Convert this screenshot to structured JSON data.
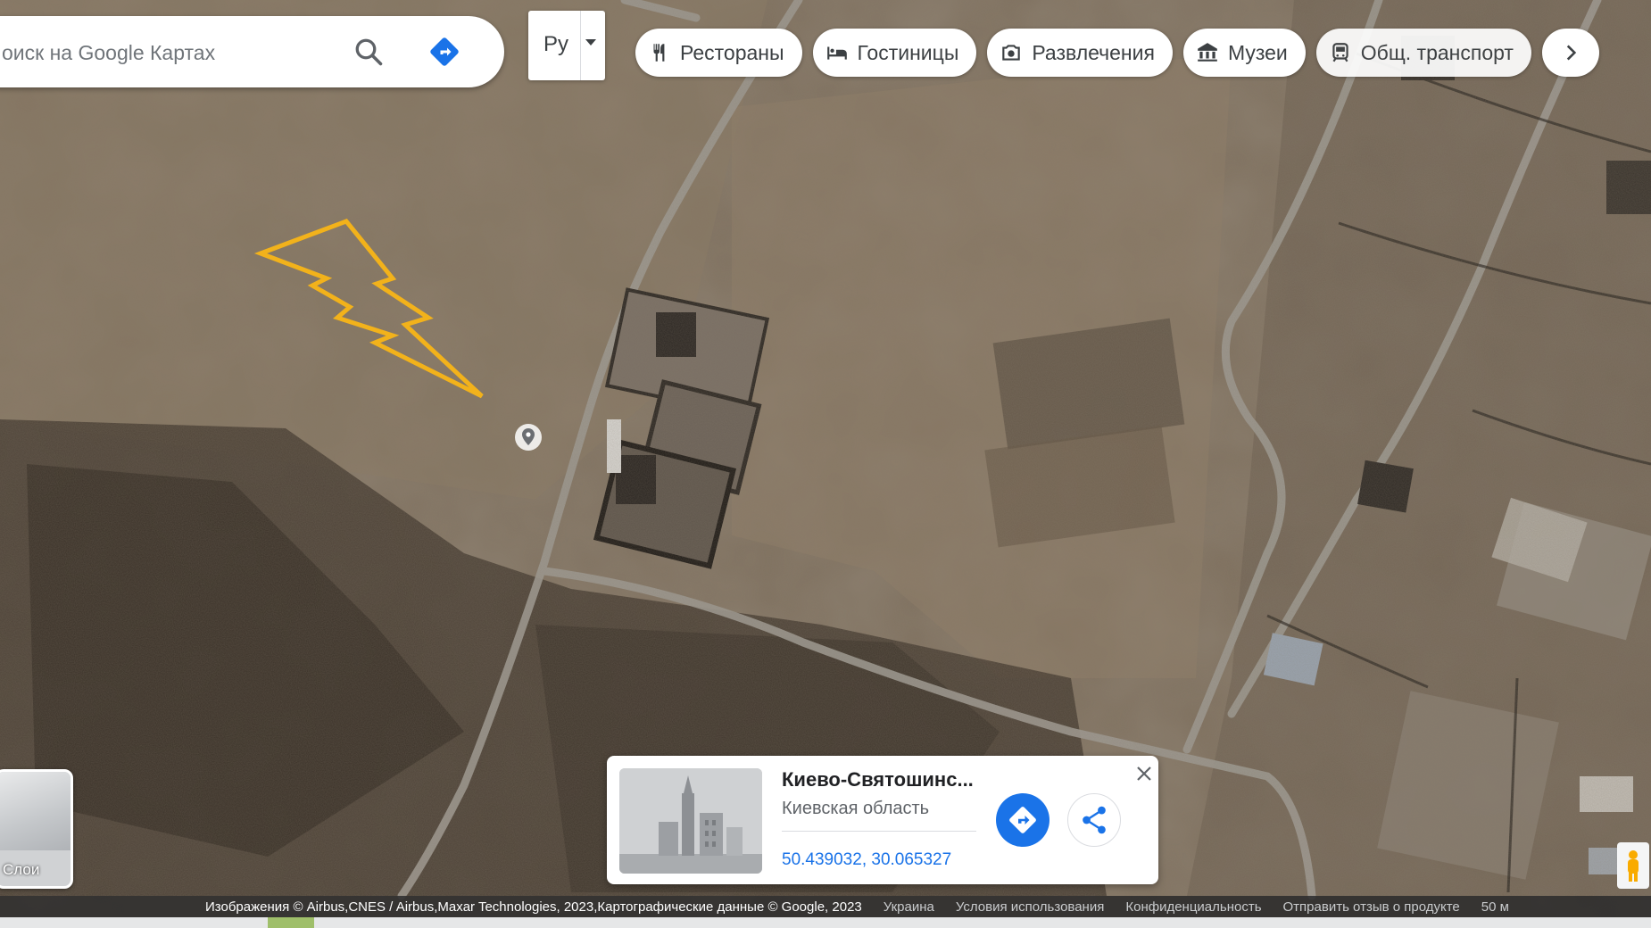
{
  "search": {
    "placeholder": "Поиск на Google Картах",
    "visible_text": "оиск на Google Картах"
  },
  "language": {
    "label": "Ру"
  },
  "chips": [
    {
      "label": "Рестораны",
      "icon": "restaurant-icon"
    },
    {
      "label": "Гостиницы",
      "icon": "hotel-icon"
    },
    {
      "label": "Развлечения",
      "icon": "camera-icon"
    },
    {
      "label": "Музеи",
      "icon": "museum-icon"
    },
    {
      "label": "Общ. транспорт",
      "icon": "transit-icon"
    }
  ],
  "layers": {
    "label": "Слои"
  },
  "place_card": {
    "title": "Киево-Святошинс...",
    "subtitle": "Киевская область",
    "coordinates": "50.439032, 30.065327"
  },
  "footer": {
    "attribution": "Изображения © Airbus,CNES / Airbus,Maxar Technologies, 2023,Картографические данные © Google, 2023",
    "country": "Украина",
    "terms": "Условия использования",
    "privacy": "Конфиденциальность",
    "feedback": "Отправить отзыв о продукте",
    "scale": "50 м"
  },
  "colors": {
    "accent_blue": "#1a73e8",
    "annotation_yellow": "#f2b21b",
    "terrain": "#6b5e4f"
  }
}
